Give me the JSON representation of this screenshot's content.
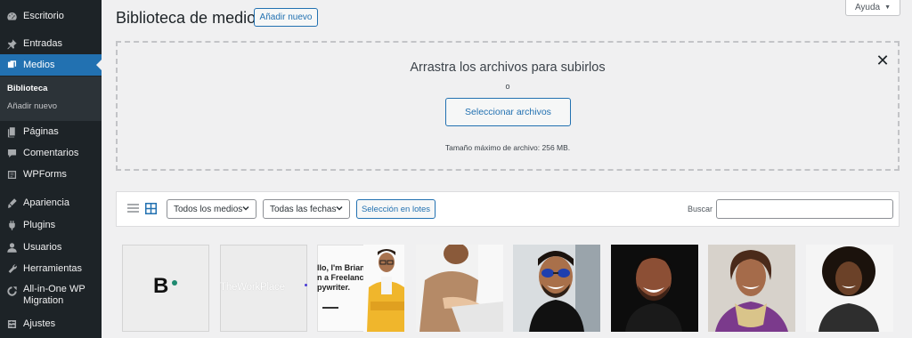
{
  "sidebar": {
    "items": [
      {
        "label": "Escritorio",
        "icon": "dashboard-icon"
      },
      {
        "label": "Entradas",
        "icon": "pin-icon"
      },
      {
        "label": "Medios",
        "icon": "media-icon"
      },
      {
        "label": "Páginas",
        "icon": "pages-icon"
      },
      {
        "label": "Comentarios",
        "icon": "comments-icon"
      },
      {
        "label": "WPForms",
        "icon": "wpforms-icon"
      },
      {
        "label": "Apariencia",
        "icon": "appearance-icon"
      },
      {
        "label": "Plugins",
        "icon": "plugins-icon"
      },
      {
        "label": "Usuarios",
        "icon": "users-icon"
      },
      {
        "label": "Herramientas",
        "icon": "tools-icon"
      },
      {
        "label": "All-in-One WP",
        "label2": "Migration",
        "icon": "migration-icon"
      },
      {
        "label": "Ajustes",
        "icon": "settings-icon"
      }
    ],
    "submenu": [
      {
        "label": "Biblioteca"
      },
      {
        "label": "Añadir nuevo"
      }
    ]
  },
  "header": {
    "title": "Biblioteca de medios",
    "add_new": "Añadir nuevo",
    "help": "Ayuda"
  },
  "uploader": {
    "title": "Arrastra los archivos para subirlos",
    "or": "o",
    "select_button": "Seleccionar archivos",
    "max_size": "Tamaño máximo de archivo: 256 MB."
  },
  "toolbar": {
    "media_filter": "Todos los medios",
    "date_filter": "Todas las fechas",
    "bulk_select": "Selección en lotes",
    "search_label": "Buscar",
    "search_value": ""
  },
  "media": {
    "thumb1_text": "B",
    "thumb2_text": "TheWorkPlace",
    "thumb3_lines": [
      "llo, I'm Brian.",
      "n a Freelance",
      "pywriter."
    ]
  },
  "colors": {
    "sidebar_bg": "#1d2327",
    "accent": "#2271b1",
    "page_bg": "#f0f0f1"
  }
}
